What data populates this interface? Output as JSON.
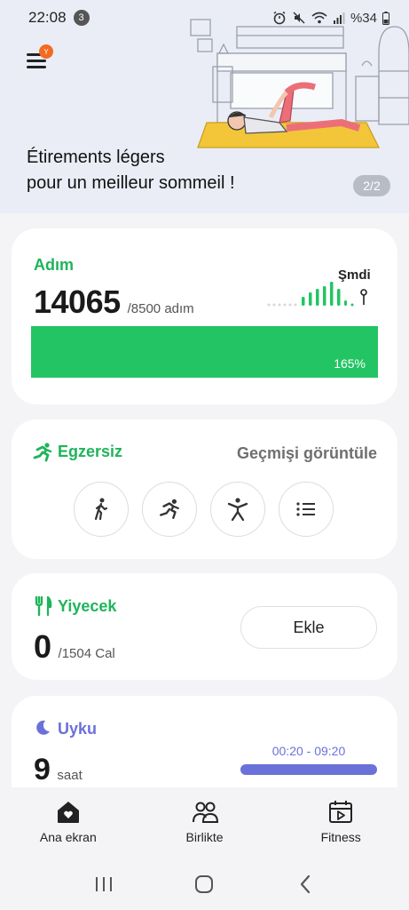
{
  "status_bar": {
    "time": "22:08",
    "notification_count": "3",
    "battery": "%34"
  },
  "banner": {
    "menu_badge": "Y",
    "title_line1": "Étirements légers",
    "title_line2": "pour un meilleur sommeil !",
    "page_indicator": "2/2",
    "accent_color": "#f26b21"
  },
  "steps": {
    "title": "Adım",
    "value": "14065",
    "goal": "/8500 adım",
    "now_label": "Şmdi",
    "progress_label": "165%",
    "progress_fraction": 1.0,
    "color": "#23c463"
  },
  "exercise": {
    "title": "Egzersiz",
    "history_label": "Geçmişi görüntüle",
    "buttons": [
      {
        "icon": "walking-icon"
      },
      {
        "icon": "running-icon"
      },
      {
        "icon": "workout-icon"
      },
      {
        "icon": "list-icon"
      }
    ]
  },
  "food": {
    "title": "Yiyecek",
    "value": "0",
    "goal": "/1504 Cal",
    "add_label": "Ekle"
  },
  "sleep": {
    "title": "Uyku",
    "value": "9",
    "unit": "saat",
    "range": "00:20 - 09:20",
    "color": "#6a71d8"
  },
  "bottom_nav": {
    "items": [
      {
        "label": "Ana ekran",
        "icon": "home-icon"
      },
      {
        "label": "Birlikte",
        "icon": "people-icon"
      },
      {
        "label": "Fitness",
        "icon": "fitness-icon"
      }
    ]
  }
}
